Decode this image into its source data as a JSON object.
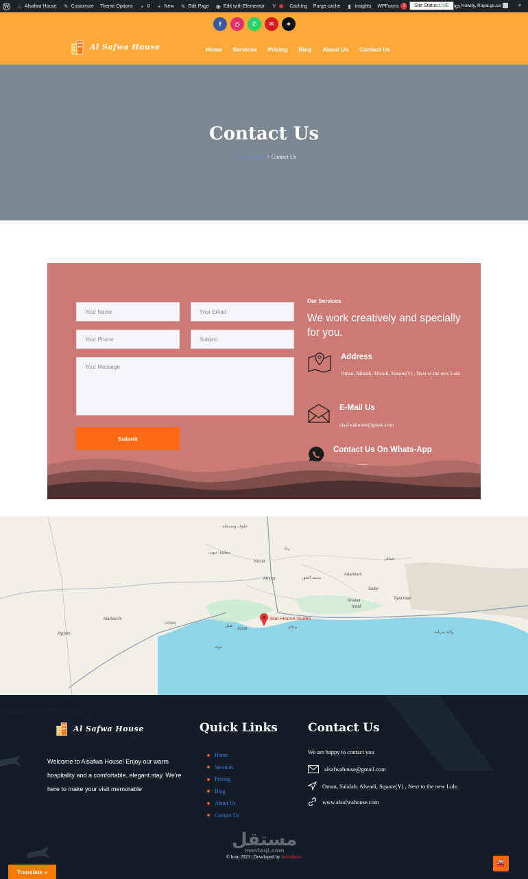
{
  "adminbar": {
    "site_name": "Alsafwa House",
    "customize": "Customize",
    "theme_options": "Theme Options",
    "comments_count": "0",
    "new": "New",
    "edit_page": "Edit Page",
    "edit_elementor": "Edit with Elementor",
    "caching": "Caching",
    "purge_cache": "Purge cache",
    "insights": "Insights",
    "wpforms": "WPForms",
    "wpforms_count": "2",
    "bookings": "No New Bookings",
    "site_status_label": "Site Status:",
    "site_status_value": "LIVE",
    "howdy": "Howdy, Royal.gs.ca"
  },
  "header": {
    "logo_text": "Al Safwa House",
    "nav": [
      "Home",
      "Services",
      "Pricing",
      "Blog",
      "About Us",
      "Contact Us"
    ],
    "socials": [
      {
        "icon": "facebook-icon",
        "color": "#3b5998",
        "glyph": "f"
      },
      {
        "icon": "instagram-icon",
        "color": "#e1306c",
        "glyph": "◎"
      },
      {
        "icon": "whatsapp-icon",
        "color": "#25d366",
        "glyph": "✆"
      },
      {
        "icon": "mail-icon",
        "color": "#d61c1c",
        "glyph": "✉"
      },
      {
        "icon": "location-icon",
        "color": "#111111",
        "glyph": "⌖"
      }
    ]
  },
  "hero": {
    "title": "Contact Us",
    "breadcrumb_home": "Alsafwa House",
    "breadcrumb_sep": " > ",
    "breadcrumb_current": "Contact Us"
  },
  "form": {
    "name_placeholder": "Your Name",
    "email_placeholder": "Your Email",
    "phone_placeholder": "Your Phone",
    "subject_placeholder": "Subject",
    "message_placeholder": "Your Message",
    "submit": "Submit"
  },
  "info": {
    "services_label": "Our Services",
    "tagline": "We work creatively and specially for you.",
    "address_title": "Address",
    "address_text": "Oman, Salalah, Alwadi, Square(Y) , Next to the new Lulu",
    "email_title": "E-Mail Us",
    "email_text": "alsafwahouse@gmail.com",
    "whatsapp_title": "Contact Us On Whats-App",
    "whatsapp_text": "+968 7967 7760"
  },
  "map": {
    "marker_label": "Star House Suites",
    "labels": [
      "Marboosh",
      "Urzuq",
      "Aydam",
      "Kusat",
      "Amnot",
      "Adanham",
      "Sailal",
      "Tawi Atair",
      "Khasur",
      "Indaf",
      "Arzat",
      "حلوف ومسحله",
      "مطبقة عيوب",
      "ريك",
      "حيحان",
      "مدينة الحق",
      "صلالة",
      "هنيل",
      "عوقد",
      "ولاية مرباط"
    ]
  },
  "footer": {
    "logo_text": "Al Safwa House",
    "about": "Welcome to Alsafwa House! Enjoy our warm hospitality and a comfortable, elegant stay. We're here to make your visit memorable",
    "quick_links_title": "Quick Links",
    "quick_links": [
      "Home",
      "Services",
      "Pricing",
      "Blog",
      "About Us",
      "Contact Us"
    ],
    "contact_title": "Contact Us",
    "contact_intro": "We are happy to contact you",
    "contact_email": "alsafwahouse@gmail.com",
    "contact_address": "Oman, Salalah, Alwadi, Square(Y) , Next to the new Lulu",
    "contact_web": "www.alsafwahouse.com",
    "copyright": "© hote 2023 | Developed by",
    "developer": "Amanbuzz",
    "watermark": "مستقل",
    "watermark_sub": "mostaql.com"
  },
  "translate": "Translate »"
}
